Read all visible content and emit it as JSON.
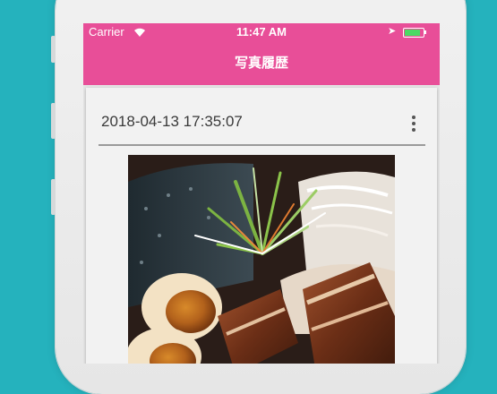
{
  "status_bar": {
    "carrier": "Carrier",
    "time": "11:47 AM",
    "battery_level": 0.85
  },
  "nav": {
    "title": "写真履歴"
  },
  "history": [
    {
      "timestamp": "2018-04-13 17:35:07",
      "menu_icon": "more-vertical-icon"
    }
  ],
  "colors": {
    "background": "#25b2bd",
    "accent": "#e84e98",
    "battery": "#4cd964"
  }
}
